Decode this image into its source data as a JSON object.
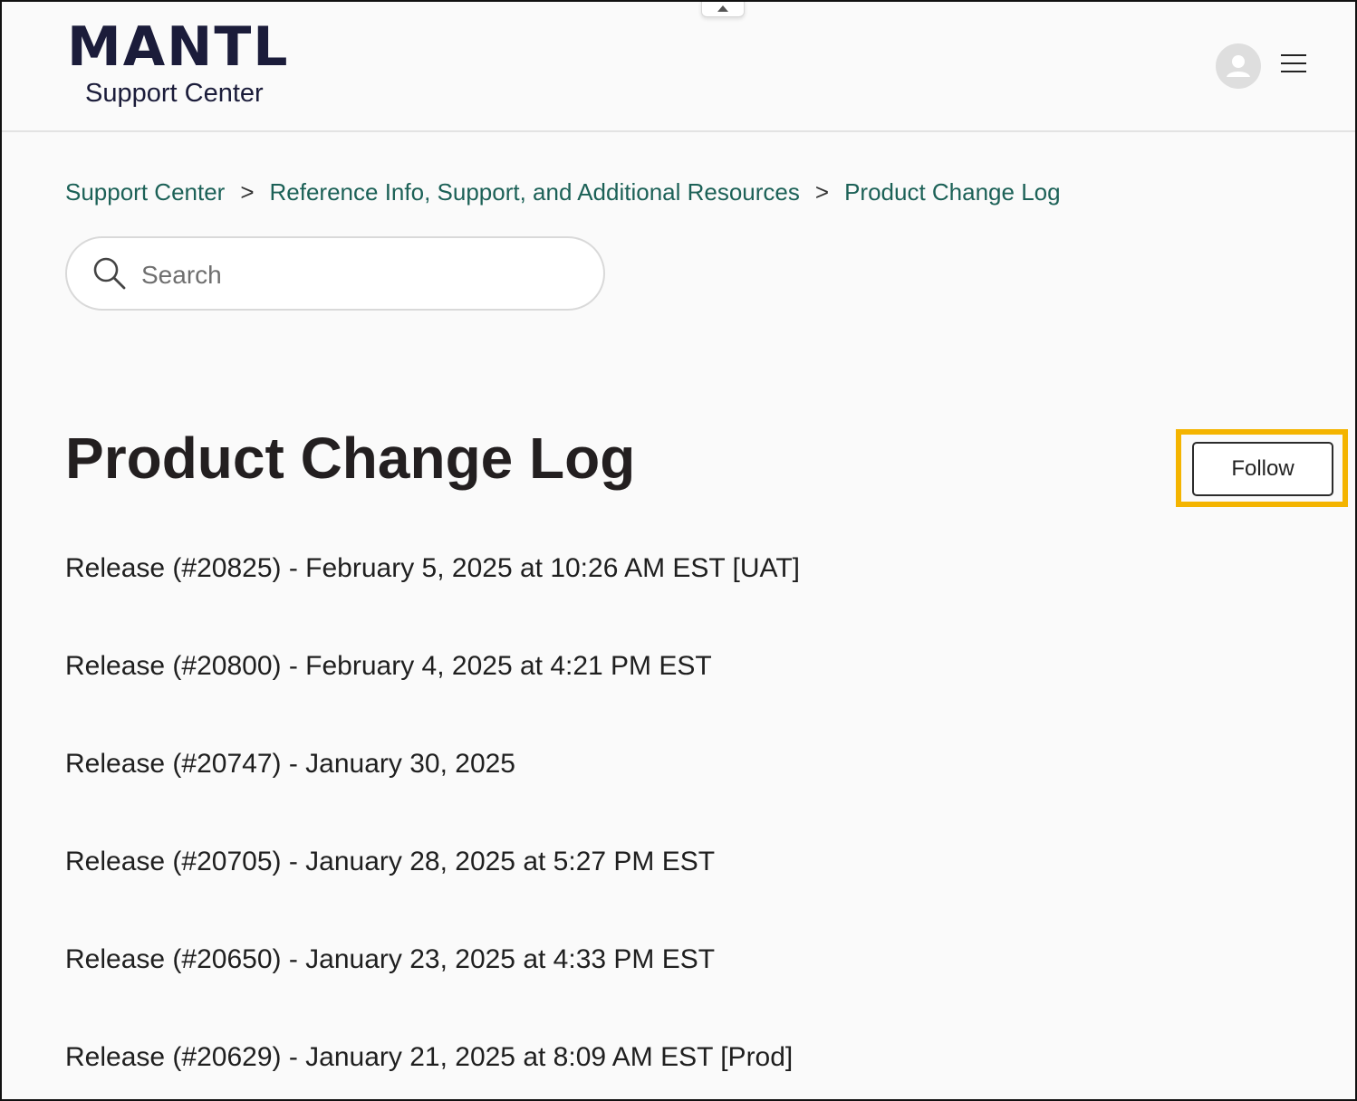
{
  "brand": {
    "logo_text": "MANTL",
    "subtitle": "Support Center"
  },
  "header": {
    "avatar_icon": "user-avatar-icon",
    "menu_icon": "hamburger-menu-icon"
  },
  "breadcrumb": {
    "items": [
      {
        "label": "Support Center"
      },
      {
        "label": "Reference Info, Support, and Additional Resources"
      },
      {
        "label": "Product Change Log"
      }
    ],
    "separator": ">"
  },
  "search": {
    "placeholder": "Search",
    "value": "",
    "icon": "search-icon"
  },
  "page": {
    "title": "Product Change Log",
    "follow_label": "Follow",
    "highlight_color": "#f4b400"
  },
  "releases": [
    {
      "label": "Release (#20825) - February 5, 2025 at 10:26 AM EST [UAT]"
    },
    {
      "label": "Release (#20800) - February 4, 2025 at 4:21 PM EST"
    },
    {
      "label": "Release (#20747) - January 30, 2025"
    },
    {
      "label": "Release (#20705) - January 28, 2025 at 5:27 PM EST"
    },
    {
      "label": "Release (#20650) - January 23, 2025 at 4:33 PM EST"
    },
    {
      "label": "Release (#20629) - January 21, 2025 at 8:09 AM EST [Prod]"
    }
  ],
  "colors": {
    "link": "#1c6157",
    "brand": "#1b1c3a",
    "background": "#fafafa"
  }
}
